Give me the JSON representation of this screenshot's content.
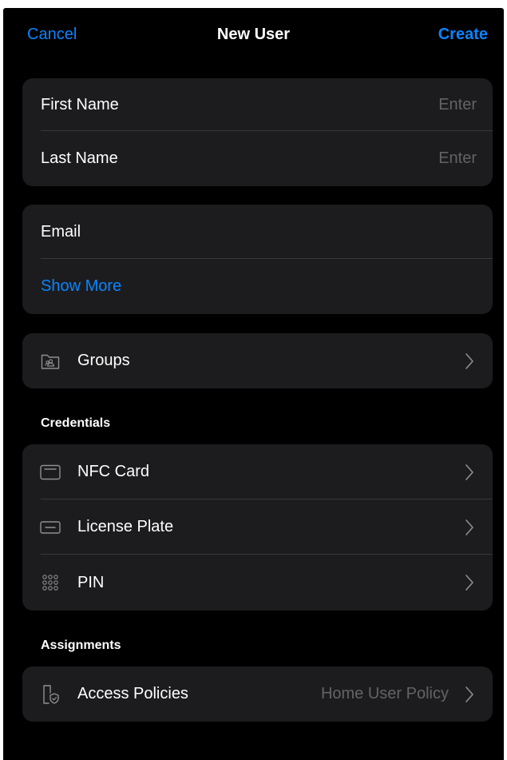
{
  "navbar": {
    "cancel_label": "Cancel",
    "title": "New User",
    "create_label": "Create"
  },
  "name_section": {
    "first_name_label": "First Name",
    "first_name_placeholder": "Enter",
    "last_name_label": "Last Name",
    "last_name_placeholder": "Enter"
  },
  "email_section": {
    "email_label": "Email",
    "show_more_label": "Show More"
  },
  "groups_section": {
    "groups_label": "Groups",
    "icon": "groups-folder-icon"
  },
  "credentials": {
    "header": "Credentials",
    "items": [
      {
        "label": "NFC Card",
        "icon": "nfc-card-icon"
      },
      {
        "label": "License Plate",
        "icon": "license-plate-icon"
      },
      {
        "label": "PIN",
        "icon": "pin-keypad-icon"
      }
    ]
  },
  "assignments": {
    "header": "Assignments",
    "access_policies_label": "Access Policies",
    "access_policies_value": "Home User Policy",
    "icon": "access-policy-icon"
  },
  "colors": {
    "accent": "#0a84ff",
    "background": "#000000",
    "card": "#1c1c1e",
    "separator": "#38383a",
    "secondary_text": "#636366",
    "icon": "#8e8e93"
  }
}
